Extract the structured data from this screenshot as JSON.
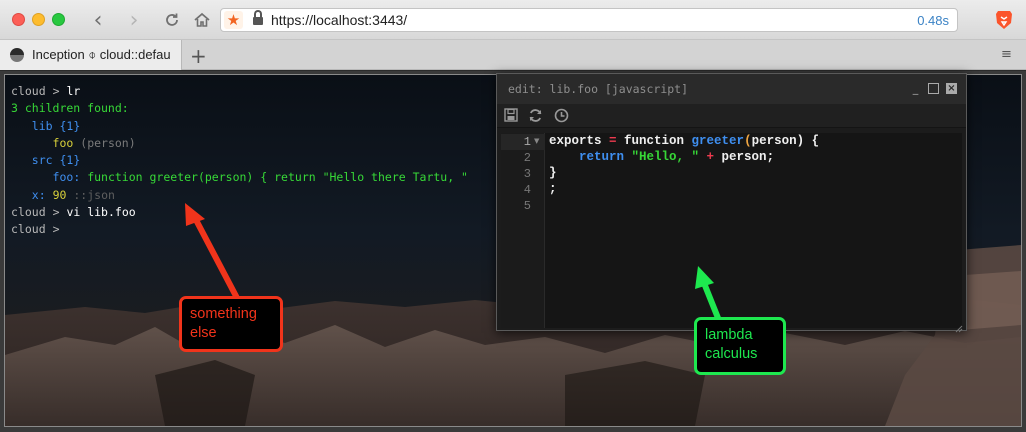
{
  "browser": {
    "url": "https://localhost:3443/",
    "load_time": "0.48s",
    "tab_title": "Inception ⌽ cloud::defau",
    "new_tab_label": "+",
    "menu_label": "≡",
    "icons": [
      "back-icon",
      "forward-icon",
      "reload-icon",
      "home-icon",
      "bookmark-star-icon",
      "lock-icon",
      "brave-lion-icon"
    ],
    "colors": {
      "bookmark_star": "#f26522",
      "load_time": "#3a82c5",
      "brave": "#fb542b"
    }
  },
  "terminal": {
    "lines": [
      {
        "prompt": "cloud",
        "sep": ">",
        "cmd": "lr"
      },
      {
        "text": "3 children found:"
      },
      {
        "name": "lib",
        "count": "{1}"
      },
      {
        "name": "foo",
        "meta": "(person)"
      },
      {
        "name": "src",
        "count": "{1}"
      },
      {
        "name": "foo:",
        "value": "function greeter(person) { return \"Hello there Tartu, \""
      },
      {
        "name": "x:",
        "value": "90",
        "meta": "::json"
      },
      {
        "prompt": "cloud",
        "sep": ">",
        "cmd": "vi lib.foo"
      },
      {
        "prompt": "cloud",
        "sep": ">",
        "cmd": ""
      }
    ],
    "colors": {
      "green": "#37d837",
      "blue": "#3f8ff0",
      "yellow": "#d8d03a"
    }
  },
  "editor": {
    "title": "edit: lib.foo [javascript]",
    "toolbar_icons": [
      "save-icon",
      "refresh-icon",
      "history-icon"
    ],
    "line_numbers": [
      "1",
      "2",
      "3",
      "4",
      "5"
    ],
    "code": {
      "l1": {
        "a": "exports",
        "b": " = ",
        "c": "function ",
        "d": "greeter",
        "e": "(",
        "f": "person",
        "g": ") {"
      },
      "l2": {
        "a": "    return ",
        "b": "\"Hello, \"",
        "c": " + ",
        "d": "person",
        "e": ";"
      },
      "l3": {
        "a": "}"
      },
      "l4": {
        "a": ";"
      }
    }
  },
  "annotations": {
    "red_label": "something else",
    "green_label": "lambda calculus",
    "colors": {
      "red": "#f1341b",
      "green": "#1ee84f"
    }
  }
}
